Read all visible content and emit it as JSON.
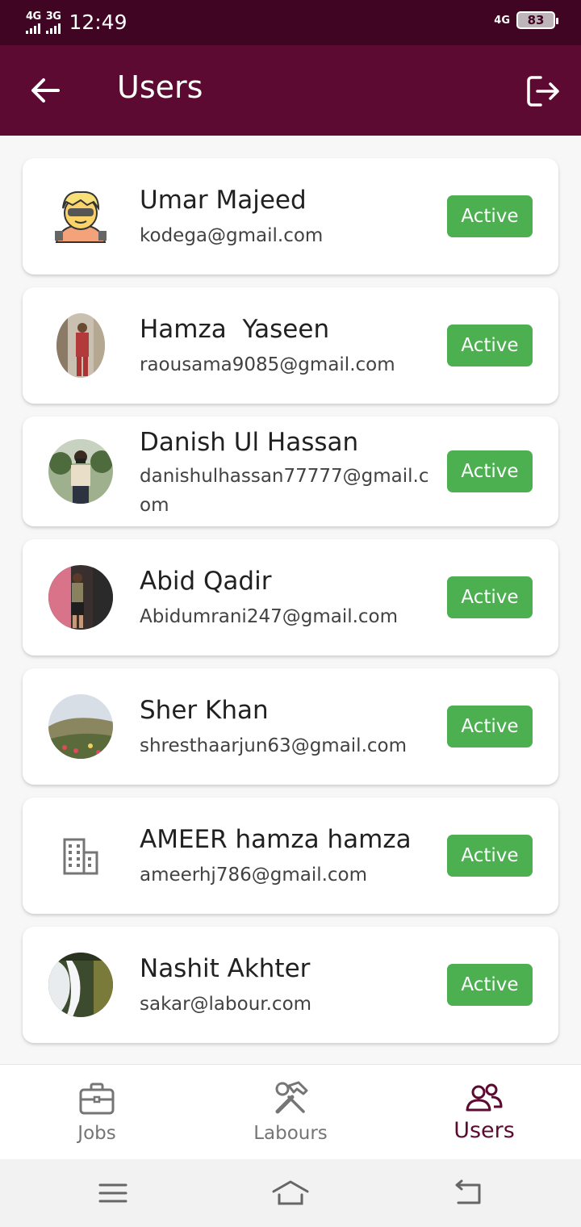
{
  "status_bar": {
    "network1": "4G",
    "network2": "3G",
    "time": "12:49",
    "network_right": "4G",
    "battery": "83"
  },
  "app_bar": {
    "title": "Users",
    "back_icon": "arrow-left-icon",
    "logout_icon": "logout-icon",
    "color": "#5c0a31"
  },
  "users": [
    {
      "name": "Umar Majeed",
      "email": "kodega@gmail.com",
      "status": "Active",
      "avatar": "cartoon-avatar"
    },
    {
      "name": "Hamza  Yaseen",
      "email": "raousama9085@gmail.com",
      "status": "Active",
      "avatar": "photo"
    },
    {
      "name": "Danish Ul Hassan",
      "email": "danishulhassan77777@gmail.com",
      "status": "Active",
      "avatar": "photo"
    },
    {
      "name": "Abid Qadir",
      "email": "Abidumrani247@gmail.com",
      "status": "Active",
      "avatar": "photo"
    },
    {
      "name": "Sher Khan",
      "email": "shresthaarjun63@gmail.com",
      "status": "Active",
      "avatar": "landscape-photo"
    },
    {
      "name": "AMEER hamza hamza",
      "email": "ameerhj786@gmail.com",
      "status": "Active",
      "avatar": "building-icon"
    },
    {
      "name": "Nashit Akhter",
      "email": "sakar@labour.com",
      "status": "Active",
      "avatar": "waterfall-photo"
    }
  ],
  "bottom_nav": {
    "items": [
      {
        "label": "Jobs",
        "icon": "briefcase-icon",
        "active": false
      },
      {
        "label": "Labours",
        "icon": "tools-icon",
        "active": false
      },
      {
        "label": "Users",
        "icon": "users-icon",
        "active": true
      }
    ]
  },
  "colors": {
    "status_active": "#4caf50",
    "primary": "#5c0a31"
  }
}
